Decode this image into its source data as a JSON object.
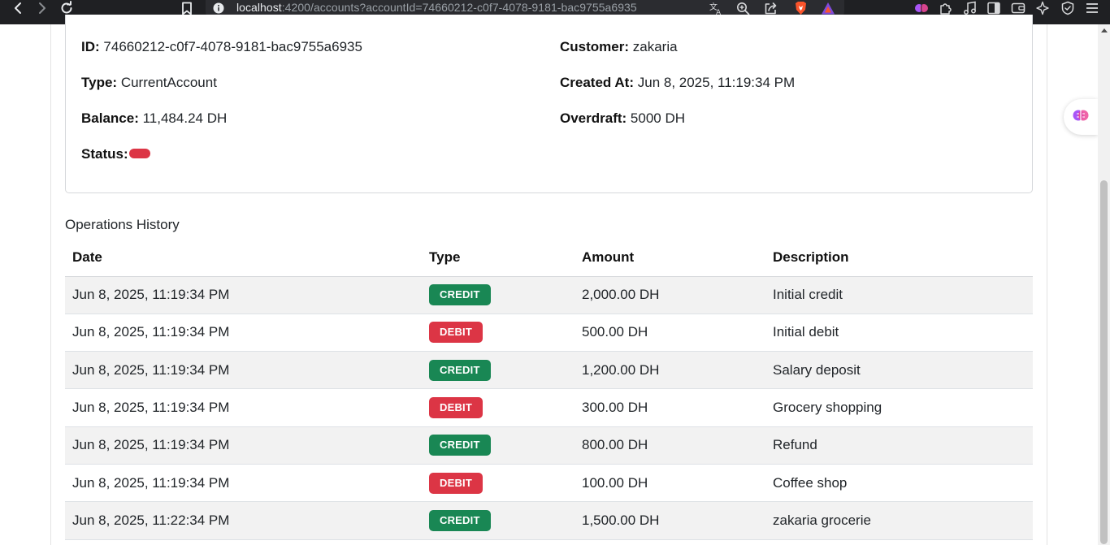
{
  "browser": {
    "url_host": "localhost",
    "url_rest": ":4200/accounts?accountId=74660212-c0f7-4078-9181-bac9755a6935",
    "nav_icons": [
      "back-icon",
      "forward-icon",
      "reload-icon",
      "bookmark-icon"
    ],
    "omnibox_icons": [
      "site-info-icon",
      "translate-icon",
      "zoom-icon",
      "share-icon",
      "brave-shields-icon",
      "brave-rewards-icon"
    ],
    "toolbar_icons": [
      "leo-ai-icon",
      "extensions-icon",
      "media-icon",
      "sidebar-icon",
      "wallet-icon",
      "customize-icon",
      "vpn-icon",
      "menu-icon"
    ]
  },
  "account": {
    "id_label": "ID:",
    "id_value": "74660212-c0f7-4078-9181-bac9755a6935",
    "customer_label": "Customer:",
    "customer_value": "zakaria",
    "type_label": "Type:",
    "type_value": "CurrentAccount",
    "created_label": "Created At:",
    "created_value": "Jun 8, 2025, 11:19:34 PM",
    "balance_label": "Balance:",
    "balance_value": "11,484.24 DH",
    "overdraft_label": "Overdraft:",
    "overdraft_value": "5000 DH",
    "status_label": "Status:",
    "status_color": "#dc3545"
  },
  "operations": {
    "title": "Operations History",
    "columns": [
      "Date",
      "Type",
      "Amount",
      "Description"
    ],
    "rows": [
      {
        "date": "Jun 8, 2025, 11:19:34 PM",
        "type": "CREDIT",
        "amount": "2,000.00 DH",
        "description": "Initial credit"
      },
      {
        "date": "Jun 8, 2025, 11:19:34 PM",
        "type": "DEBIT",
        "amount": "500.00 DH",
        "description": "Initial debit"
      },
      {
        "date": "Jun 8, 2025, 11:19:34 PM",
        "type": "CREDIT",
        "amount": "1,200.00 DH",
        "description": "Salary deposit"
      },
      {
        "date": "Jun 8, 2025, 11:19:34 PM",
        "type": "DEBIT",
        "amount": "300.00 DH",
        "description": "Grocery shopping"
      },
      {
        "date": "Jun 8, 2025, 11:19:34 PM",
        "type": "CREDIT",
        "amount": "800.00 DH",
        "description": "Refund"
      },
      {
        "date": "Jun 8, 2025, 11:19:34 PM",
        "type": "DEBIT",
        "amount": "100.00 DH",
        "description": "Coffee shop"
      },
      {
        "date": "Jun 8, 2025, 11:22:34 PM",
        "type": "CREDIT",
        "amount": "1,500.00 DH",
        "description": "zakaria grocerie"
      }
    ]
  },
  "colors": {
    "credit": "#198754",
    "debit": "#dc3545",
    "chrome_bg": "#1f2023",
    "row_stripe": "#f2f2f2"
  }
}
